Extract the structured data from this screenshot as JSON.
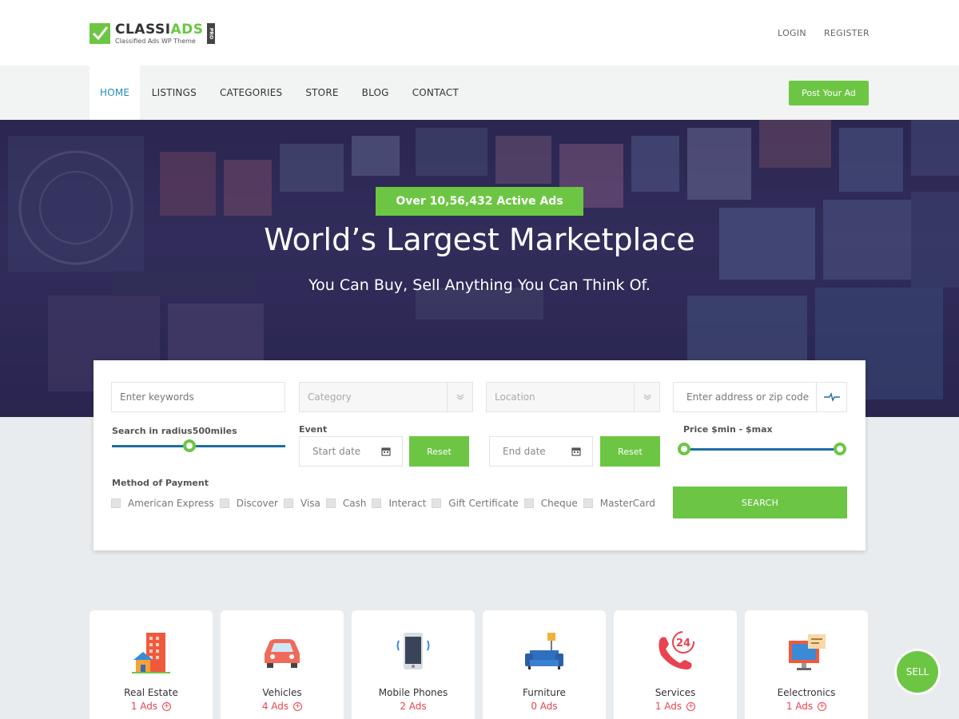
{
  "header": {
    "logo_title_a": "CLASSI",
    "logo_title_b": "ADS",
    "logo_subtitle": "Classified Ads WP Theme",
    "logo_badge": "PRO",
    "login": "LOGIN",
    "register": "REGISTER"
  },
  "nav": {
    "items": [
      "HOME",
      "LISTINGS",
      "CATEGORIES",
      "STORE",
      "BLOG",
      "CONTACT"
    ],
    "active": "HOME",
    "post_button": "Post Your Ad"
  },
  "hero": {
    "badge": "Over 10,56,432 Active Ads",
    "title": "World’s Largest Marketplace",
    "subtitle": "You Can Buy, Sell Anything You Can Think Of."
  },
  "search": {
    "keywords_placeholder": "Enter keywords",
    "category_placeholder": "Category",
    "location_placeholder": "Location",
    "address_placeholder": "Enter address or zip code",
    "radius_label": "Search in radius500miles",
    "event_label": "Event",
    "start_date_placeholder": "Start date",
    "end_date_placeholder": "End date",
    "reset_label": "Reset",
    "price_label": "Price $min - $max",
    "payment_label": "Method of Payment",
    "payment_methods": [
      "American Express",
      "Discover",
      "Visa",
      "Cash",
      "Interact",
      "Gift Certificate",
      "Cheque",
      "MasterCard"
    ],
    "search_button": "SEARCH"
  },
  "categories": [
    {
      "name": "Real Estate",
      "ads": "1 Ads",
      "icon": "building-icon",
      "has_plus": true
    },
    {
      "name": "Vehicles",
      "ads": "4 Ads",
      "icon": "car-icon",
      "has_plus": true
    },
    {
      "name": "Mobile Phones",
      "ads": "2 Ads",
      "icon": "phone-icon",
      "has_plus": false
    },
    {
      "name": "Furniture",
      "ads": "0 Ads",
      "icon": "sofa-icon",
      "has_plus": false
    },
    {
      "name": "Services",
      "ads": "1 Ads",
      "icon": "phone-24-icon",
      "has_plus": true
    },
    {
      "name": "Eelectronics",
      "ads": "1 Ads",
      "icon": "monitor-icon",
      "has_plus": true
    }
  ],
  "sell_button": "SELL",
  "colors": {
    "accent_green": "#6cc644",
    "link_blue": "#1e8fc2",
    "slider_blue": "#1e6fa3",
    "ads_red": "#e8434f"
  }
}
